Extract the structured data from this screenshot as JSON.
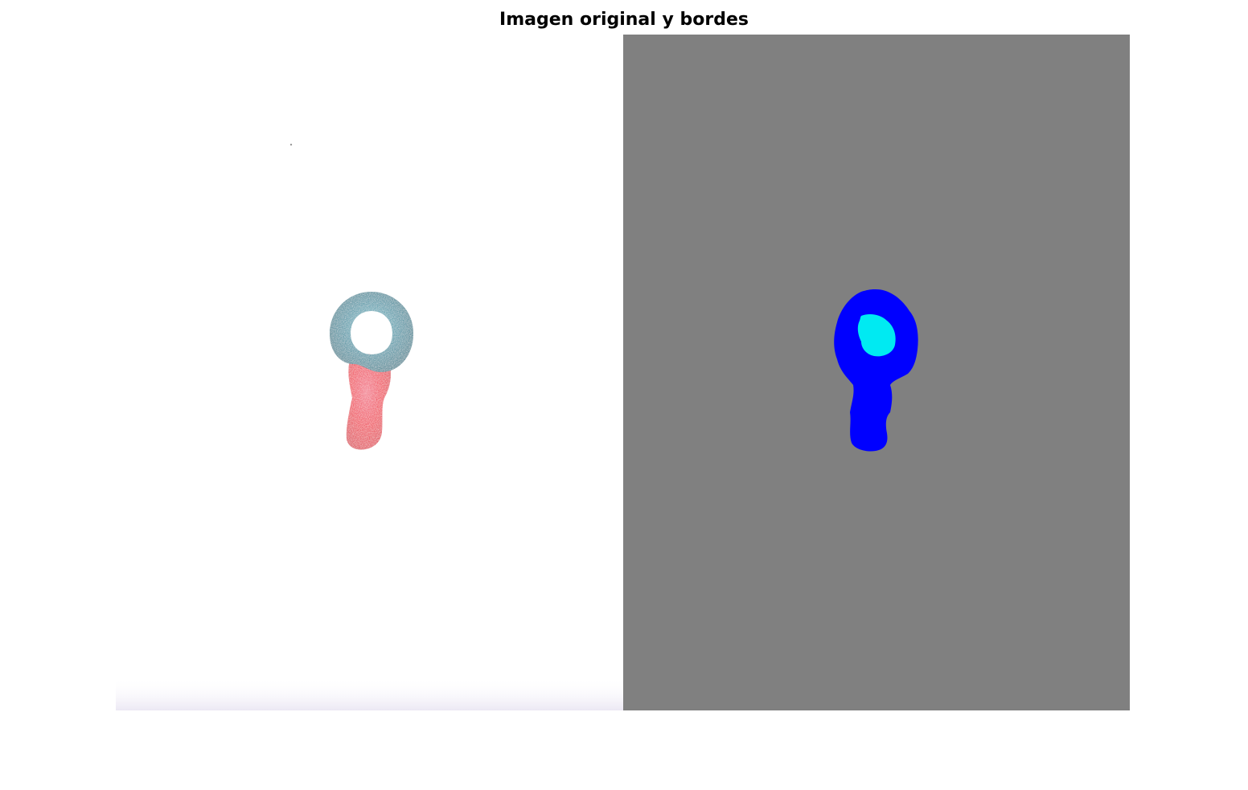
{
  "figure": {
    "title": "Imagen original y bordes"
  },
  "panels": [
    {
      "kind": "photograph",
      "subject": "gummy-candy",
      "colors": {
        "background": "#ffffff",
        "ring": "#2f8ea0",
        "stem": "#ef1a3a"
      }
    },
    {
      "kind": "label-map",
      "colors": {
        "background": "#808080",
        "object": "#0000ff",
        "hole": "#00eaf2"
      }
    }
  ]
}
